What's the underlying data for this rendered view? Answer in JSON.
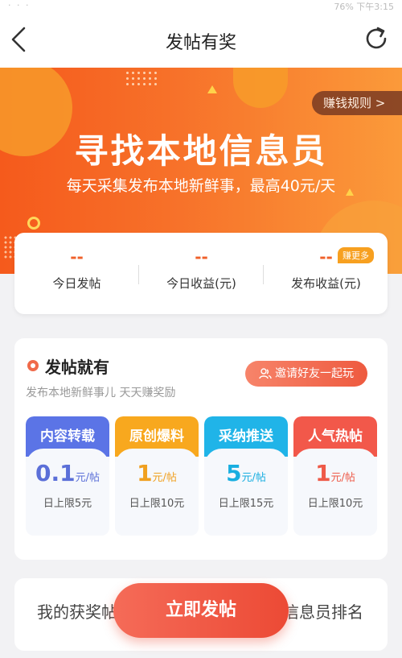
{
  "statusbar": {
    "left": "",
    "right": "76%  下午3:15"
  },
  "navbar": {
    "title": "发帖有奖"
  },
  "banner": {
    "rules_label": "赚钱规则 >",
    "title": "寻找本地信息员",
    "subtitle": "每天采集发布本地新鲜事，最高40元/天"
  },
  "stats": {
    "items": [
      {
        "value": "--",
        "label": "今日发帖"
      },
      {
        "value": "--",
        "label": "今日收益(元)"
      },
      {
        "value": "--",
        "label": "发布收益(元)"
      }
    ],
    "more_badge": "赚更多"
  },
  "earn": {
    "title": "发帖就有",
    "subtitle": "发布本地新鲜事儿 天天赚奖励",
    "invite_label": "邀请好友一起玩",
    "tiles": [
      {
        "name": "内容转载",
        "price": "0.1",
        "unit": "元/帖",
        "limit": "日上限5元",
        "color": "#5b74e6",
        "price_color": "#5b6fd8"
      },
      {
        "name": "原创爆料",
        "price": "1",
        "unit": "元/帖",
        "limit": "日上限10元",
        "color": "#f8a81e",
        "price_color": "#f0a020"
      },
      {
        "name": "采纳推送",
        "price": "5",
        "unit": "元/帖",
        "limit": "日上限15元",
        "color": "#20b4e8",
        "price_color": "#18aee0"
      },
      {
        "name": "人气热帖",
        "price": "1",
        "unit": "元/帖",
        "limit": "日上限10元",
        "color": "#f2584a",
        "price_color": "#ee5a48"
      }
    ]
  },
  "bottom": {
    "left_label": "我的获奖帖",
    "right_label": "信息员排名",
    "post_button": "立即发帖"
  }
}
